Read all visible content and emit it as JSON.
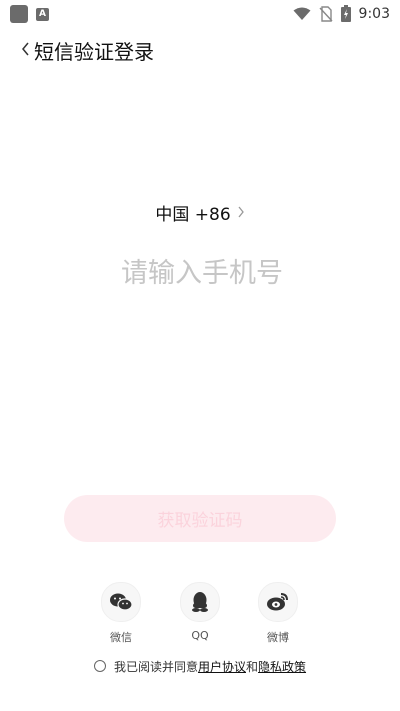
{
  "status_bar": {
    "time": "9:03",
    "icons": [
      "app-square-icon",
      "a-badge-icon",
      "wifi-icon",
      "no-sim-icon",
      "battery-charging-icon"
    ],
    "a_badge": "A"
  },
  "header": {
    "title": "短信验证登录",
    "back_icon": "chevron-left-icon"
  },
  "country": {
    "label": "中国 +86"
  },
  "phone": {
    "placeholder": "请输入手机号",
    "value": ""
  },
  "code_button": {
    "label": "获取验证码",
    "color": "#fdebef",
    "text_color": "#fbd3dc"
  },
  "social": [
    {
      "icon": "wechat-icon",
      "label": "微信"
    },
    {
      "icon": "qq-icon",
      "label": "QQ"
    },
    {
      "icon": "weibo-icon",
      "label": "微博"
    }
  ],
  "agreement": {
    "prefix": "我已阅读并同意",
    "user_agreement": "用户协议",
    "and": "和",
    "privacy_policy": "隐私政策"
  }
}
